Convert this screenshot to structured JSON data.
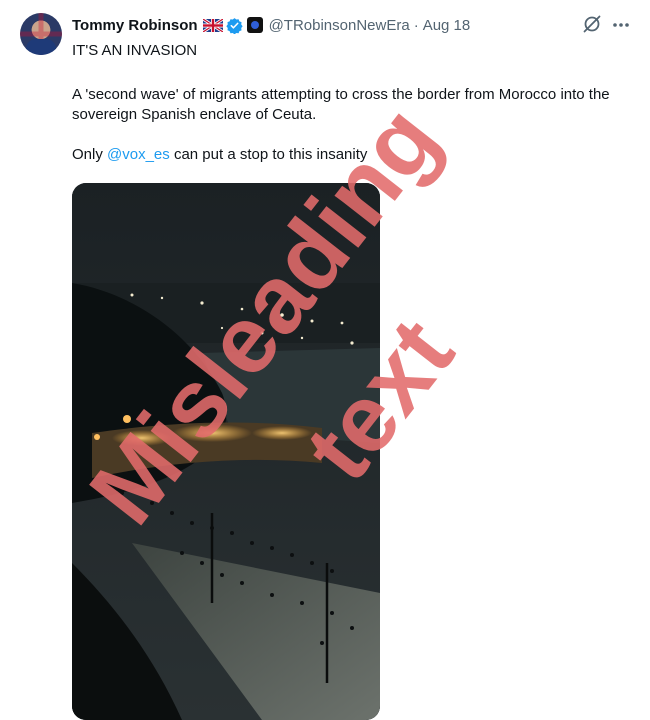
{
  "tweet": {
    "author_name": "Tommy Robinson",
    "handle": "@TRobinsonNewEra",
    "separator": "·",
    "date": "Aug 18",
    "text_line1": "IT'S AN INVASION",
    "text_line2": "A 'second wave' of migrants attempting to cross the border from Morocco into the sovereign Spanish enclave of Ceuta.",
    "text_line3_prefix": "Only ",
    "mention": "@vox_es",
    "text_line3_suffix": " can put a stop to this insanity"
  },
  "icons": {
    "flag": "uk-flag-icon",
    "verified": "verified-badge-icon",
    "affiliation": "affiliation-badge-icon",
    "grok": "grok-icon",
    "more": "more-icon"
  },
  "overlay": {
    "word1": "Misleading",
    "word2": "text",
    "color": "#e06060"
  },
  "colors": {
    "link": "#1d9bf0",
    "secondary_text": "#536471",
    "verified": "#1d9bf0"
  }
}
